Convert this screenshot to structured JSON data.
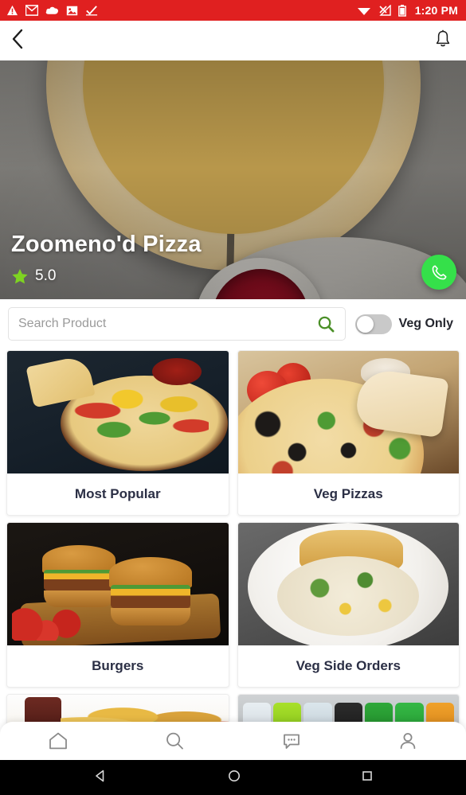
{
  "status_bar": {
    "time": "1:20 PM",
    "background_color": "#e02020",
    "left_icons": [
      "warning-triangle-icon",
      "gmail-icon",
      "cloud-icon",
      "image-icon",
      "check-icon"
    ],
    "right_icons": [
      "wifi-icon",
      "signal-off-icon",
      "battery-icon"
    ]
  },
  "app_bar": {
    "back_icon": "back-chevron-icon",
    "notification_icon": "bell-icon"
  },
  "hero": {
    "restaurant_name": "Zoomeno'd Pizza",
    "rating": "5.0",
    "star_icon": "star-icon",
    "star_color": "#7ed321",
    "call_icon": "phone-icon",
    "call_button_color": "#35e04a",
    "photo_description": "pizza-sauce-chicken-photo"
  },
  "search": {
    "placeholder": "Search Product",
    "value": "",
    "icon": "search-icon",
    "icon_color": "#4a8f27",
    "veg_only_label": "Veg Only",
    "veg_only_on": false,
    "toggle_track_color": "#c9c9c9"
  },
  "categories": [
    {
      "label": "Most Popular",
      "image": "dark-pizza-peppers-photo"
    },
    {
      "label": "Veg Pizzas",
      "image": "veg-pizza-olives-photo"
    },
    {
      "label": "Burgers",
      "image": "double-burgers-board-photo"
    },
    {
      "label": "Veg Side Orders",
      "image": "creamy-pasta-garlic-bread-photo"
    },
    {
      "label": "",
      "image": "food-platter-photo"
    },
    {
      "label": "",
      "image": "beverage-bottles-photo"
    }
  ],
  "bottom_nav": [
    {
      "name": "home",
      "icon": "home-icon"
    },
    {
      "name": "search",
      "icon": "search-icon"
    },
    {
      "name": "chat",
      "icon": "chat-bubble-icon"
    },
    {
      "name": "profile",
      "icon": "person-icon"
    }
  ],
  "android_nav": [
    {
      "name": "back",
      "icon": "triangle-back-icon"
    },
    {
      "name": "home",
      "icon": "circle-home-icon"
    },
    {
      "name": "recents",
      "icon": "square-recents-icon"
    }
  ]
}
